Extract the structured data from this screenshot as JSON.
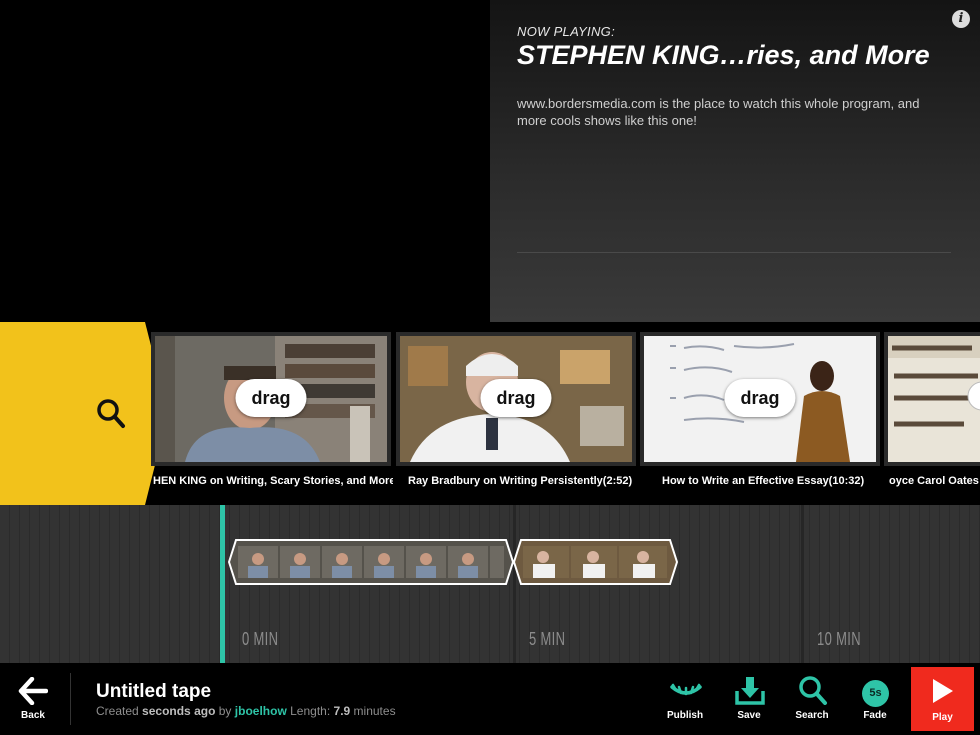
{
  "now_playing": {
    "label": "NOW PLAYING:",
    "title": "STEPHEN KING…ries, and More",
    "description": "www.bordersmedia.com is the place to watch this whole program, and more cools shows like this one!",
    "info_icon": "i"
  },
  "search_results": {
    "drag_label": "drag",
    "clips": [
      {
        "title": "HEN KING on Writing, Scary Stories, and More",
        "drag": "drag"
      },
      {
        "title": "Ray Bradbury on Writing Persistently(2:52)",
        "drag": "drag"
      },
      {
        "title": "How to Write an Effective Essay(10:32)",
        "drag": "drag"
      },
      {
        "title": "oyce Carol Oates -"
      }
    ]
  },
  "timeline": {
    "markers": [
      "0 MIN",
      "5 MIN",
      "10 MIN"
    ]
  },
  "tape": {
    "title": "Untitled tape",
    "created_prefix": "Created",
    "created_when": "seconds ago",
    "by": "by",
    "user": "jboelhow",
    "length_label": "Length:",
    "length_value": "7.9",
    "length_unit": "minutes"
  },
  "toolbar": {
    "back": "Back",
    "publish": "Publish",
    "save": "Save",
    "search": "Search",
    "fade": "Fade",
    "fade_value": "5s",
    "play": "Play"
  },
  "colors": {
    "accent_teal": "#2ec4a7",
    "search_yellow": "#f2c21b",
    "play_red": "#f02a1e"
  }
}
